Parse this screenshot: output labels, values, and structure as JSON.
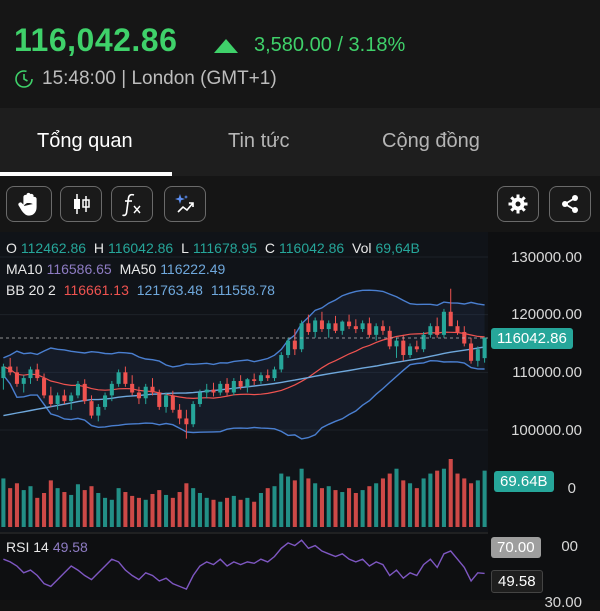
{
  "header": {
    "price": "116,042.86",
    "change": "3,580.00 / 3.18%",
    "time": "15:48:00 | London (GMT+1)"
  },
  "tabs": [
    {
      "label": "Tổng quan",
      "active": true
    },
    {
      "label": "Tin tức",
      "active": false
    },
    {
      "label": "Cộng đồng",
      "active": false
    }
  ],
  "toolbar": {
    "icons": [
      "hand-icon",
      "candlestick-icon",
      "function-icon",
      "magic-trend-icon",
      "gear-icon",
      "share-icon"
    ]
  },
  "ohlc": {
    "o_label": "O",
    "o": "112462.86",
    "h_label": "H",
    "h": "116042.86",
    "l_label": "L",
    "l": "111678.95",
    "c_label": "C",
    "c": "116042.86",
    "vol_label": "Vol",
    "vol": "69,64B"
  },
  "ma": {
    "ma10_label": "MA10",
    "ma10": "116586.65",
    "ma50_label": "MA50",
    "ma50": "116222.49"
  },
  "bb": {
    "label": "BB 20 2",
    "mid": "116661.13",
    "upper": "121763.48",
    "lower": "111558.78"
  },
  "rsi": {
    "label": "RSI 14",
    "value": "49.58"
  },
  "axis": {
    "price_ticks": [
      "130000.00",
      "120000.00",
      "110000.00",
      "100000.00"
    ],
    "current_price": "116042.86",
    "volume_tag": "69.64B",
    "volume_tick_fragment": "0",
    "rsi_70": "70.00",
    "rsi_70_fragment": "00",
    "rsi_value": "49.58",
    "rsi_bottom_tick": "30.00"
  },
  "colors": {
    "up": "#26a69a",
    "down": "#ef5350",
    "green_text": "#3fd16a",
    "ma10": "#8e7cc3",
    "ma50": "#6fa8dc",
    "bb_mid": "#ef5350",
    "bb_band": "#4a7fd0",
    "rsi": "#7e57c2"
  },
  "chart_data": {
    "type": "candlestick",
    "title": "",
    "ylim": [
      95000,
      132000
    ],
    "candles": [
      [
        109000,
        111500,
        107000,
        111000
      ],
      [
        111000,
        112500,
        109500,
        110000
      ],
      [
        110000,
        111000,
        107500,
        108000
      ],
      [
        108000,
        109500,
        106500,
        109000
      ],
      [
        109000,
        111000,
        108000,
        110500
      ],
      [
        110500,
        111500,
        108500,
        109000
      ],
      [
        109000,
        109800,
        105500,
        106000
      ],
      [
        106000,
        107500,
        104000,
        104500
      ],
      [
        104500,
        106500,
        103500,
        106000
      ],
      [
        106000,
        107000,
        104500,
        105000
      ],
      [
        105000,
        106500,
        103500,
        106000
      ],
      [
        106000,
        108500,
        105500,
        108000
      ],
      [
        108000,
        108800,
        104500,
        105000
      ],
      [
        105000,
        106000,
        102000,
        102500
      ],
      [
        102500,
        104500,
        101500,
        104000
      ],
      [
        104000,
        106500,
        103500,
        106000
      ],
      [
        106000,
        108500,
        105000,
        108000
      ],
      [
        108000,
        110500,
        107500,
        110000
      ],
      [
        110000,
        111000,
        107500,
        108000
      ],
      [
        108000,
        109500,
        106000,
        106500
      ],
      [
        106500,
        107500,
        104500,
        105500
      ],
      [
        105500,
        108000,
        104500,
        107500
      ],
      [
        107500,
        109000,
        106000,
        106500
      ],
      [
        106500,
        107000,
        103500,
        104000
      ],
      [
        104000,
        106500,
        103000,
        106000
      ],
      [
        106000,
        106800,
        103000,
        103500
      ],
      [
        103500,
        104500,
        101000,
        102000
      ],
      [
        102000,
        103500,
        98500,
        101000
      ],
      [
        101000,
        105000,
        100500,
        104500
      ],
      [
        104500,
        107000,
        104000,
        106500
      ],
      [
        106500,
        108000,
        105500,
        107000
      ],
      [
        107000,
        108200,
        105800,
        106500
      ],
      [
        106500,
        108500,
        106000,
        108000
      ],
      [
        108000,
        109000,
        106000,
        106500
      ],
      [
        106500,
        109000,
        106000,
        108500
      ],
      [
        108500,
        109500,
        107000,
        107500
      ],
      [
        107500,
        109000,
        106500,
        108800
      ],
      [
        108800,
        109800,
        107800,
        108500
      ],
      [
        108500,
        110000,
        108000,
        109500
      ],
      [
        109500,
        110500,
        108500,
        109000
      ],
      [
        109000,
        111000,
        108500,
        110500
      ],
      [
        110500,
        113500,
        110000,
        113000
      ],
      [
        113000,
        116000,
        112500,
        115500
      ],
      [
        115500,
        117500,
        113000,
        114000
      ],
      [
        114000,
        119000,
        113500,
        118500
      ],
      [
        118500,
        120000,
        116500,
        117000
      ],
      [
        117000,
        119500,
        116000,
        119000
      ],
      [
        119000,
        120500,
        117000,
        117500
      ],
      [
        117500,
        119000,
        116000,
        118500
      ],
      [
        118500,
        119800,
        116800,
        117200
      ],
      [
        117200,
        119000,
        116500,
        118800
      ],
      [
        118800,
        120000,
        117500,
        118000
      ],
      [
        118000,
        119200,
        116800,
        117500
      ],
      [
        117500,
        119000,
        117000,
        118500
      ],
      [
        118500,
        119500,
        116000,
        116500
      ],
      [
        116500,
        118500,
        115500,
        118000
      ],
      [
        118000,
        119000,
        116500,
        117200
      ],
      [
        117200,
        118000,
        114000,
        114500
      ],
      [
        114500,
        116000,
        112500,
        115500
      ],
      [
        115500,
        116500,
        112000,
        113000
      ],
      [
        113000,
        115000,
        112500,
        114500
      ],
      [
        114500,
        115500,
        113500,
        114000
      ],
      [
        114000,
        117000,
        113500,
        116500
      ],
      [
        116500,
        118500,
        116000,
        118000
      ],
      [
        118000,
        119500,
        116000,
        116500
      ],
      [
        116500,
        121000,
        116000,
        120500
      ],
      [
        120500,
        124500,
        120000,
        118000
      ],
      [
        118000,
        119000,
        116500,
        117000
      ],
      [
        117000,
        118000,
        114500,
        115000
      ],
      [
        115000,
        116000,
        111500,
        112000
      ],
      [
        112000,
        114500,
        111000,
        114000
      ],
      [
        112462.86,
        116042.86,
        111678.95,
        116042.86
      ]
    ],
    "volume": [
      50,
      40,
      45,
      38,
      42,
      30,
      35,
      48,
      40,
      36,
      33,
      44,
      38,
      42,
      35,
      30,
      28,
      40,
      36,
      32,
      30,
      28,
      34,
      38,
      33,
      30,
      36,
      45,
      40,
      35,
      30,
      28,
      26,
      30,
      32,
      28,
      30,
      26,
      35,
      40,
      42,
      55,
      52,
      48,
      60,
      50,
      45,
      40,
      42,
      38,
      36,
      40,
      35,
      38,
      42,
      45,
      50,
      55,
      60,
      48,
      45,
      40,
      50,
      55,
      58,
      60,
      70,
      55,
      50,
      45,
      48,
      58
    ],
    "rsi": [
      60,
      58,
      55,
      50,
      52,
      48,
      42,
      40,
      45,
      50,
      55,
      52,
      48,
      45,
      50,
      55,
      60,
      58,
      52,
      48,
      45,
      50,
      48,
      44,
      46,
      42,
      40,
      38,
      48,
      55,
      58,
      56,
      60,
      55,
      58,
      56,
      58,
      57,
      60,
      58,
      62,
      68,
      72,
      70,
      74,
      68,
      70,
      66,
      64,
      62,
      64,
      60,
      58,
      60,
      55,
      58,
      56,
      48,
      52,
      46,
      50,
      48,
      56,
      60,
      54,
      64,
      66,
      60,
      54,
      44,
      50,
      49.58
    ]
  }
}
